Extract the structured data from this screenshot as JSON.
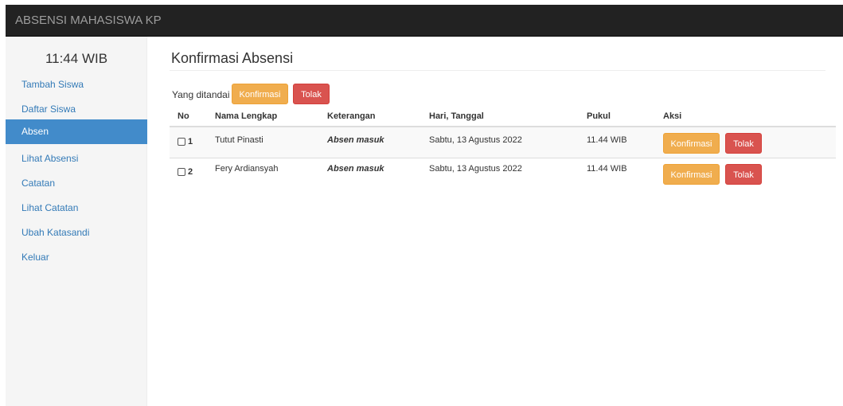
{
  "navbar": {
    "brand": "ABSENSI MAHASISWA KP"
  },
  "sidebar": {
    "clock": "11:44 WIB",
    "items": [
      {
        "label": "Tambah Siswa",
        "active": false
      },
      {
        "label": "Daftar Siswa",
        "active": false
      },
      {
        "label": "Absen",
        "active": true
      },
      {
        "label": "Lihat Absensi",
        "active": false
      },
      {
        "label": "Catatan",
        "active": false
      },
      {
        "label": "Lihat Catatan",
        "active": false
      },
      {
        "label": "Ubah Katasandi",
        "active": false
      },
      {
        "label": "Keluar",
        "active": false
      }
    ]
  },
  "main": {
    "title": "Konfirmasi Absensi",
    "marked_label": "Yang ditandai :",
    "bulk_confirm_label": "Konfirmasi",
    "bulk_reject_label": "Tolak",
    "table": {
      "headers": [
        "No",
        "Nama Lengkap",
        "Keterangan",
        "Hari, Tanggal",
        "Pukul",
        "Aksi"
      ],
      "rows": [
        {
          "no": "1",
          "name": "Tutut Pinasti",
          "note": "Absen masuk",
          "date": "Sabtu, 13 Agustus 2022",
          "time": "11.44 WIB",
          "confirm_label": "Konfirmasi",
          "reject_label": "Tolak"
        },
        {
          "no": "2",
          "name": "Fery Ardiansyah",
          "note": "Absen masuk",
          "date": "Sabtu, 13 Agustus 2022",
          "time": "11.44 WIB",
          "confirm_label": "Konfirmasi",
          "reject_label": "Tolak"
        }
      ]
    }
  },
  "colors": {
    "navbar_bg": "#222222",
    "sidebar_bg": "#f5f5f5",
    "active_item": "#428bca",
    "link": "#337ab7",
    "warning": "#f0ad4e",
    "danger": "#d9534f"
  }
}
